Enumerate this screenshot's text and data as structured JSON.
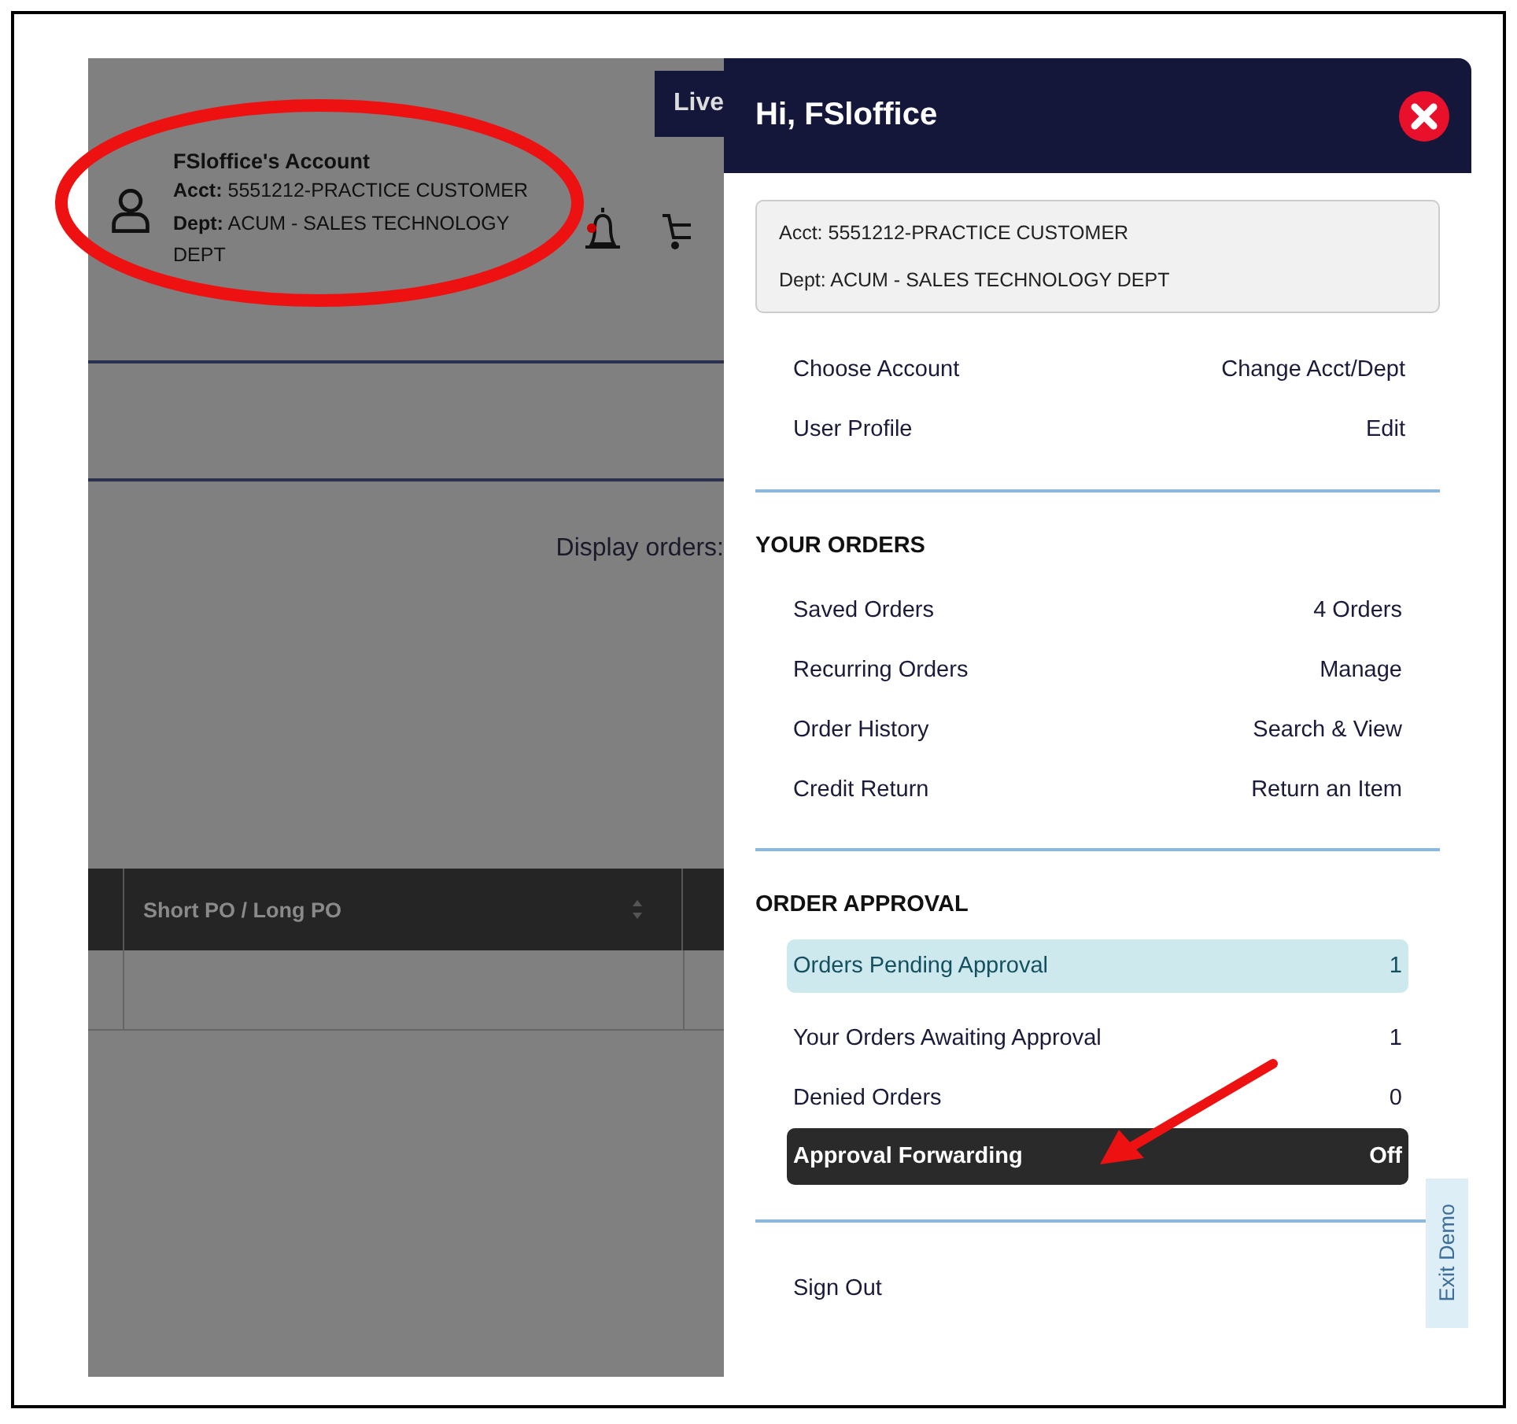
{
  "background": {
    "live_tab": "Live",
    "account": {
      "title": "FSloffice's Account",
      "acct": "**Acct:** 5551212-PRACTICE CUSTOMER",
      "dept": "**Dept:** ACUM - SALES TECHNOLOGY DEPT"
    },
    "display_orders": "Display orders:",
    "table": {
      "columns": [
        "Short PO / Long PO"
      ]
    }
  },
  "panel": {
    "title": "Hi, FSloffice",
    "account_box": [
      "Acct: 5551212-PRACTICE CUSTOMER",
      "Dept: ACUM - SALES TECHNOLOGY DEPT"
    ],
    "links": [
      {
        "label": "Choose Account",
        "action": "Change Acct/Dept"
      },
      {
        "label": "User Profile",
        "action": "Edit"
      }
    ],
    "sections": [
      {
        "heading": "YOUR ORDERS",
        "items": [
          {
            "label": "Saved Orders",
            "value": "4 Orders",
            "kind": "plain"
          },
          {
            "label": "Recurring Orders",
            "value": "Manage",
            "kind": "plain"
          },
          {
            "label": "Order History",
            "value": "Search & View",
            "kind": "plain"
          },
          {
            "label": "Credit Return",
            "value": "Return an Item",
            "kind": "plain"
          }
        ]
      },
      {
        "heading": "ORDER APPROVAL",
        "items": [
          {
            "label": "Orders Pending Approval",
            "value": "1",
            "kind": "highlight"
          },
          {
            "label": "Your Orders Awaiting Approval",
            "value": "1",
            "kind": "plain"
          },
          {
            "label": "Denied Orders",
            "value": "0",
            "kind": "plain"
          },
          {
            "label": "Approval Forwarding",
            "value": "Off",
            "kind": "dark"
          }
        ]
      }
    ],
    "sign_out": "Sign Out",
    "exit_demo": "Exit Demo"
  }
}
